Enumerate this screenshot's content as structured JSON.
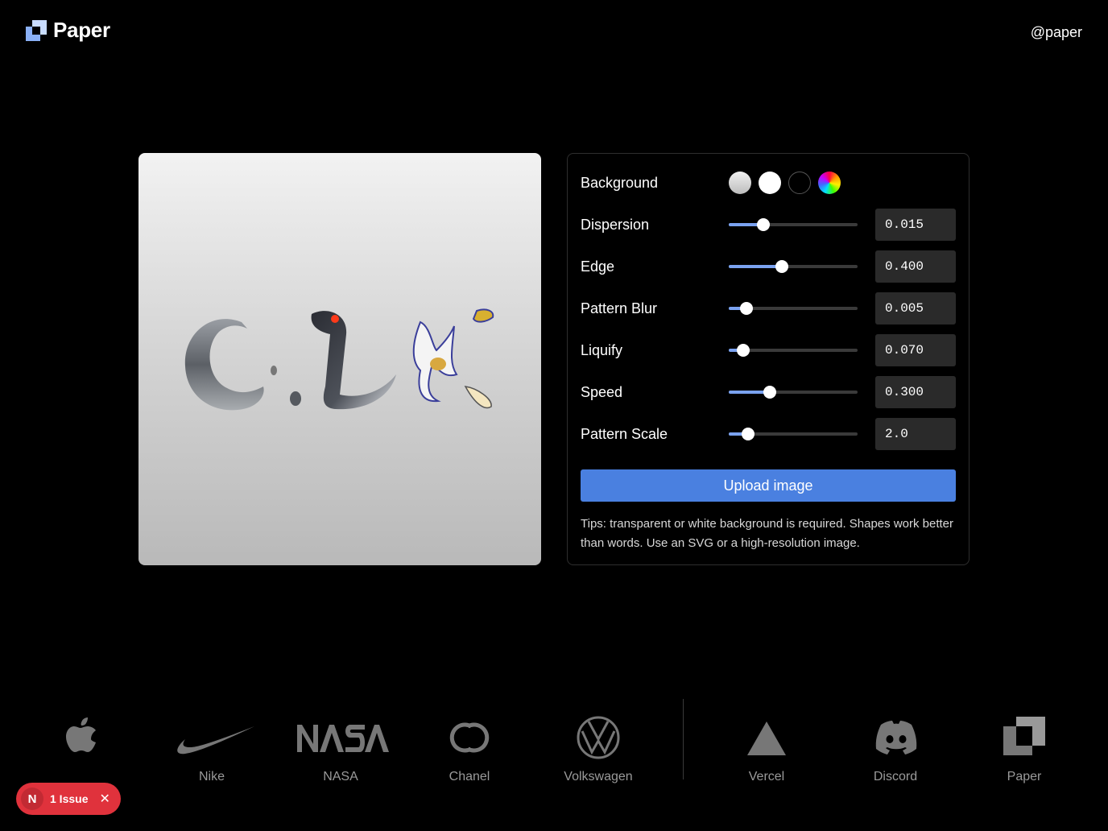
{
  "header": {
    "brand_name": "Paper",
    "handle": "@paper"
  },
  "controls": {
    "background": {
      "label": "Background",
      "options": [
        "gradient",
        "white",
        "black",
        "rainbow"
      ]
    },
    "params": [
      {
        "label": "Dispersion",
        "value": "0.015",
        "level": 0.27
      },
      {
        "label": "Edge",
        "value": "0.400",
        "level": 0.41
      },
      {
        "label": "Pattern Blur",
        "value": "0.005",
        "level": 0.14
      },
      {
        "label": "Liquify",
        "value": "0.070",
        "level": 0.11
      },
      {
        "label": "Speed",
        "value": "0.300",
        "level": 0.32
      },
      {
        "label": "Pattern Scale",
        "value": "2.0",
        "level": 0.15
      }
    ],
    "upload_label": "Upload image",
    "tips": "Tips: transparent or white background is required. Shapes work better than words. Use an SVG or a high-resolution image."
  },
  "logos": [
    {
      "label": "",
      "icon": "apple-icon"
    },
    {
      "label": "Nike",
      "icon": "nike-icon"
    },
    {
      "label": "NASA",
      "icon": "nasa-icon"
    },
    {
      "label": "Chanel",
      "icon": "chanel-icon"
    },
    {
      "label": "Volkswagen",
      "icon": "volkswagen-icon"
    },
    {
      "label": "Vercel",
      "icon": "vercel-icon"
    },
    {
      "label": "Discord",
      "icon": "discord-icon"
    },
    {
      "label": "Paper",
      "icon": "paper-icon"
    }
  ],
  "issue_badge": {
    "letter": "N",
    "text": "1 Issue"
  },
  "colors": {
    "accent": "#4a80e0",
    "slider_fill": "#7aa2f0",
    "issue": "#e0323c"
  }
}
